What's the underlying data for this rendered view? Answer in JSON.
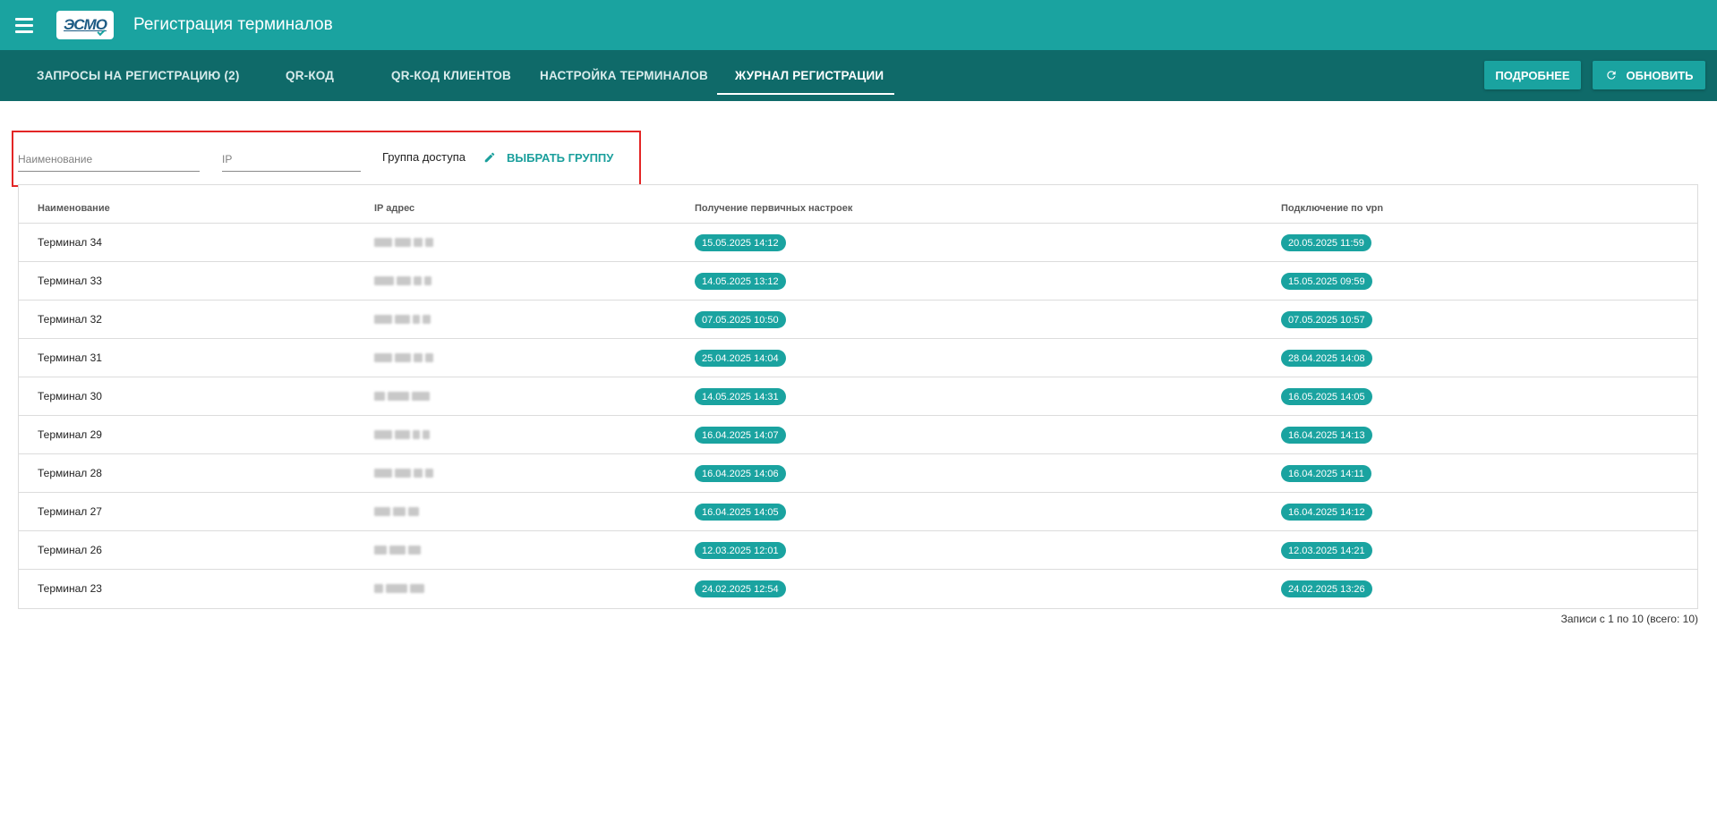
{
  "header": {
    "title": "Регистрация терминалов",
    "logo_text": "ЭСМО"
  },
  "tabs": [
    {
      "label": "ЗАПРОСЫ НА РЕГИСТРАЦИЮ (2)"
    },
    {
      "label": "QR-КОД"
    },
    {
      "label": "QR-КОД КЛИЕНТОВ"
    },
    {
      "label": "НАСТРОЙКА ТЕРМИНАЛОВ"
    },
    {
      "label": "ЖУРНАЛ РЕГИСТРАЦИИ"
    }
  ],
  "toolbar": {
    "details_label": "ПОДРОБНЕЕ",
    "refresh_label": "ОБНОВИТЬ"
  },
  "filters": {
    "name_placeholder": "Наименование",
    "ip_placeholder": "IP",
    "group_label": "Группа доступа",
    "pick_group_label": "ВЫБРАТЬ ГРУППУ"
  },
  "table": {
    "columns": [
      "Наименование",
      "IP адрес",
      "Получение первичных настроек",
      "Подключение по vpn"
    ],
    "rows": [
      {
        "name": "Терминал 34",
        "initial": "15.05.2025 14:12",
        "vpn": "20.05.2025 11:59"
      },
      {
        "name": "Терминал 33",
        "initial": "14.05.2025 13:12",
        "vpn": "15.05.2025 09:59"
      },
      {
        "name": "Терминал 32",
        "initial": "07.05.2025 10:50",
        "vpn": "07.05.2025 10:57"
      },
      {
        "name": "Терминал 31",
        "initial": "25.04.2025 14:04",
        "vpn": "28.04.2025 14:08"
      },
      {
        "name": "Терминал 30",
        "initial": "14.05.2025 14:31",
        "vpn": "16.05.2025 14:05"
      },
      {
        "name": "Терминал 29",
        "initial": "16.04.2025 14:07",
        "vpn": "16.04.2025 14:13"
      },
      {
        "name": "Терминал 28",
        "initial": "16.04.2025 14:06",
        "vpn": "16.04.2025 14:11"
      },
      {
        "name": "Терминал 27",
        "initial": "16.04.2025 14:05",
        "vpn": "16.04.2025 14:12"
      },
      {
        "name": "Терминал 26",
        "initial": "12.03.2025 12:01",
        "vpn": "12.03.2025 14:21"
      },
      {
        "name": "Терминал 23",
        "initial": "24.02.2025 12:54",
        "vpn": "24.02.2025 13:26"
      }
    ]
  },
  "pager": {
    "text": "Записи с 1 по 10 (всего: 10)"
  },
  "colors": {
    "primary": "#1aa3a0",
    "primary_dark": "#0f6a69",
    "highlight": "#e32626"
  },
  "icons": {
    "menu": "menu-icon",
    "refresh": "refresh-icon",
    "edit": "pencil-icon"
  }
}
